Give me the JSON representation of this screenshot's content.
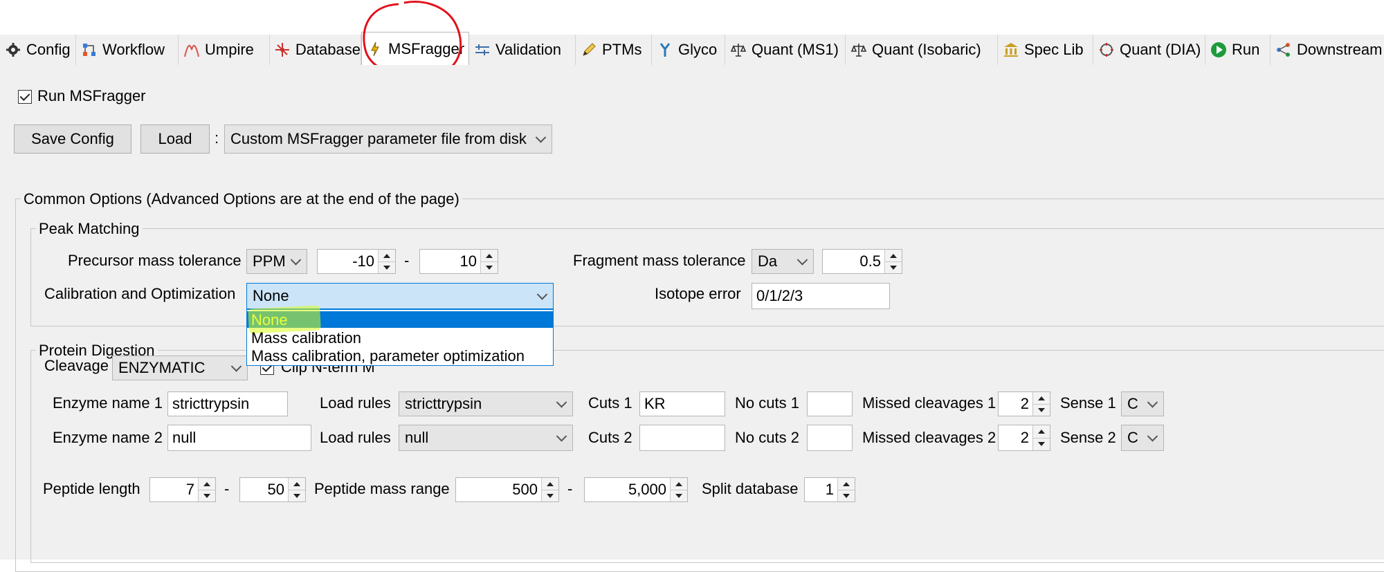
{
  "tabs": [
    {
      "label": "Config",
      "icon": "gear-icon"
    },
    {
      "label": "Workflow",
      "icon": "workflow-icon"
    },
    {
      "label": "Umpire",
      "icon": "umpire-icon"
    },
    {
      "label": "Database",
      "icon": "database-icon"
    },
    {
      "label": "MSFragger",
      "icon": "msfragger-icon"
    },
    {
      "label": "Validation",
      "icon": "validation-icon"
    },
    {
      "label": "PTMs",
      "icon": "pencil-icon"
    },
    {
      "label": "Glyco",
      "icon": "glyco-icon"
    },
    {
      "label": "Quant (MS1)",
      "icon": "scale-icon"
    },
    {
      "label": "Quant (Isobaric)",
      "icon": "scale-icon"
    },
    {
      "label": "Spec Lib",
      "icon": "library-icon"
    },
    {
      "label": "Quant (DIA)",
      "icon": "dia-icon"
    },
    {
      "label": "Run",
      "icon": "run-icon"
    },
    {
      "label": "Downstream",
      "icon": "downstream-icon"
    }
  ],
  "active_tab": "MSFragger",
  "colors": {
    "accent_red": "#e3101a",
    "highlight": "#d8ff1a",
    "selection": "#0078d7"
  },
  "run_msfragger": {
    "label": "Run MSFragger",
    "checked": true
  },
  "toolbar": {
    "save_label": "Save Config",
    "load_label": "Load",
    "colon": ":",
    "param_source": "Custom MSFragger parameter file from disk"
  },
  "common_options": {
    "title": "Common Options (Advanced Options are at the end of the page)"
  },
  "peak_matching": {
    "title": "Peak Matching",
    "precursor_label": "Precursor mass tolerance",
    "precursor_unit": "PPM",
    "precursor_low": "-10",
    "dash": "-",
    "precursor_high": "10",
    "fragment_label": "Fragment mass tolerance",
    "fragment_unit": "Da",
    "fragment_value": "0.5",
    "calibration_label": "Calibration and Optimization",
    "calibration_value": "None",
    "calibration_options": [
      "None",
      "Mass calibration",
      "Mass calibration, parameter optimization"
    ],
    "isotope_label": "Isotope error",
    "isotope_value": "0/1/2/3"
  },
  "digestion": {
    "title": "Protein Digestion",
    "cleavage_label": "Cleavage",
    "cleavage_value": "ENZYMATIC",
    "clip_label": "Clip N-term M",
    "enzyme1": {
      "name_label": "Enzyme name 1",
      "name": "stricttrypsin",
      "rules_label": "Load rules",
      "rules": "stricttrypsin",
      "cuts_label": "Cuts 1",
      "cuts": "KR",
      "nocuts_label": "No cuts 1",
      "nocuts": "",
      "missed_label": "Missed cleavages 1",
      "missed": "2",
      "sense_label": "Sense 1",
      "sense": "C"
    },
    "enzyme2": {
      "name_label": "Enzyme name 2",
      "name": "null",
      "rules_label": "Load rules",
      "rules": "null",
      "cuts_label": "Cuts 2",
      "cuts": "",
      "nocuts_label": "No cuts 2",
      "nocuts": "",
      "missed_label": "Missed cleavages 2",
      "missed": "2",
      "sense_label": "Sense 2",
      "sense": "C"
    },
    "peptide_length_label": "Peptide length",
    "peptide_length_min": "7",
    "peptide_length_max": "50",
    "mass_range_label": "Peptide mass range",
    "mass_min": "500",
    "mass_max": "5,000",
    "split_label": "Split database",
    "split_value": "1"
  }
}
